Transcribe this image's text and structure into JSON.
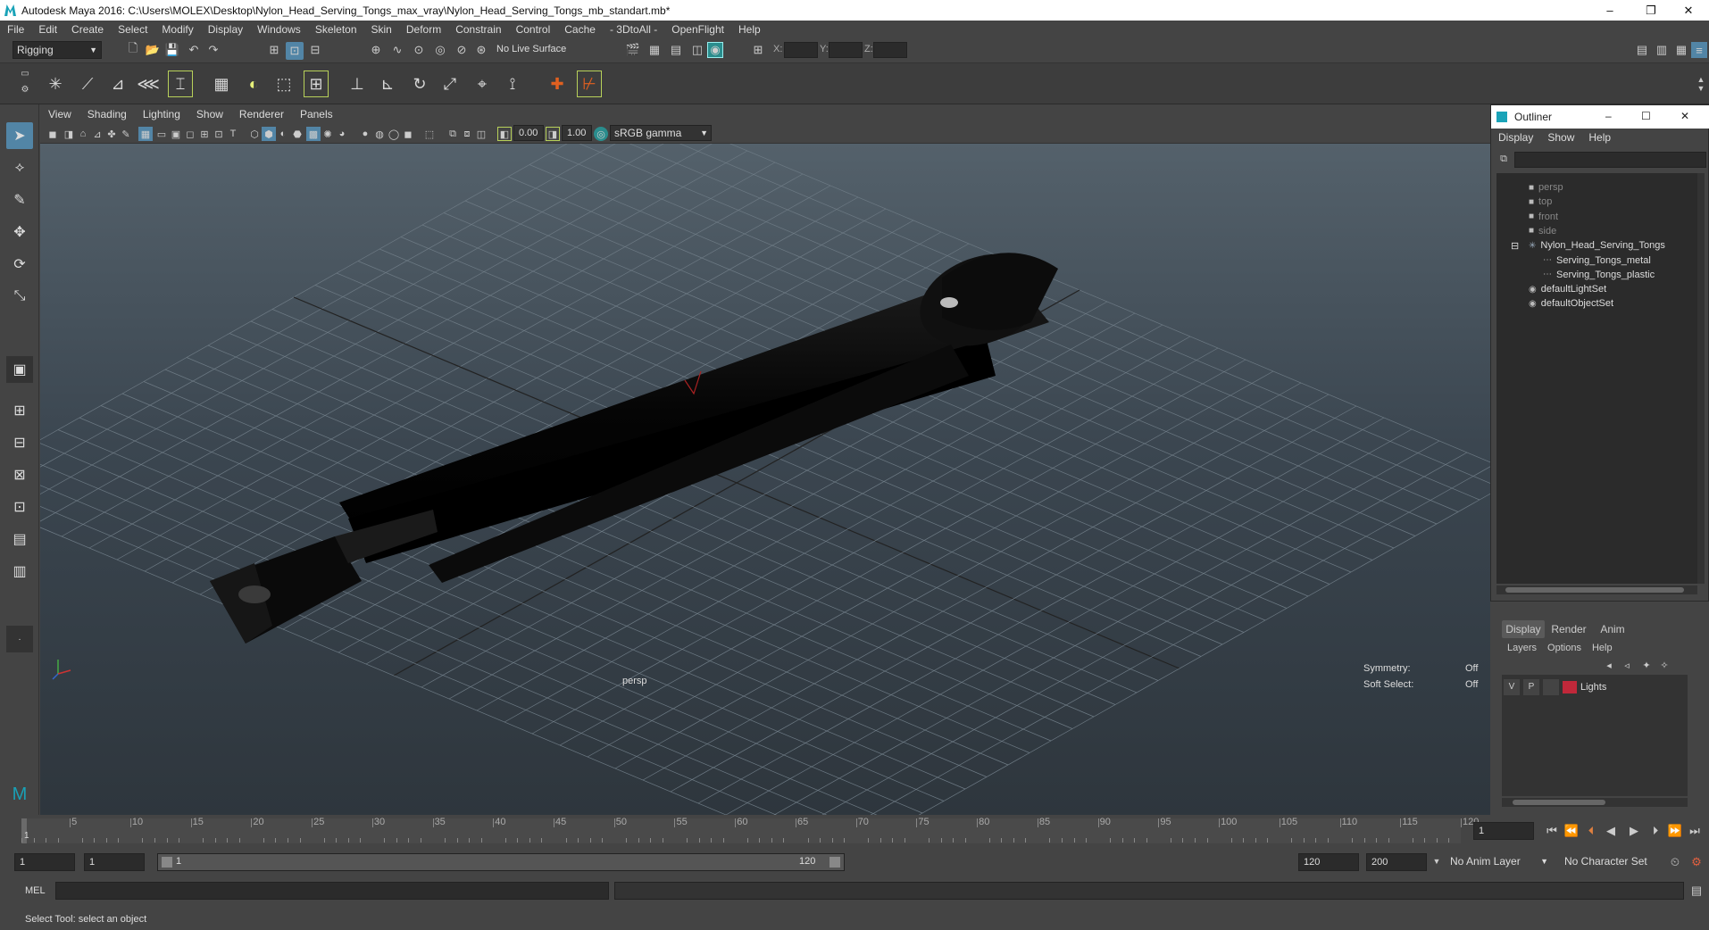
{
  "window": {
    "title": "Autodesk Maya 2016: C:\\Users\\MOLEX\\Desktop\\Nylon_Head_Serving_Tongs_max_vray\\Nylon_Head_Serving_Tongs_mb_standart.mb*",
    "minimize": "–",
    "maximize": "❐",
    "close": "✕"
  },
  "menubar": [
    "File",
    "Edit",
    "Create",
    "Select",
    "Modify",
    "Display",
    "Windows",
    "Skeleton",
    "Skin",
    "Deform",
    "Constrain",
    "Control",
    "Cache",
    "- 3DtoAll -",
    "OpenFlight",
    "Help"
  ],
  "status": {
    "menuset": "Rigging",
    "live_surface": "No Live Surface",
    "x_label": "X:",
    "y_label": "Y:",
    "z_label": "Z:"
  },
  "viewport_menu": [
    "View",
    "Shading",
    "Lighting",
    "Show",
    "Renderer",
    "Panels"
  ],
  "viewport_toolbar": {
    "exposure": "0.00",
    "gamma": "1.00",
    "color_space": "sRGB gamma"
  },
  "viewport": {
    "camera_label": "persp",
    "symmetry_label": "Symmetry:",
    "symmetry_value": "Off",
    "soft_select_label": "Soft Select:",
    "soft_select_value": "Off"
  },
  "outliner": {
    "title": "Outliner",
    "menu": [
      "Display",
      "Show",
      "Help"
    ],
    "items": [
      {
        "label": "persp",
        "type": "camera"
      },
      {
        "label": "top",
        "type": "camera"
      },
      {
        "label": "front",
        "type": "camera"
      },
      {
        "label": "side",
        "type": "camera"
      },
      {
        "label": "Nylon_Head_Serving_Tongs",
        "type": "group"
      },
      {
        "label": "Serving_Tongs_metal",
        "type": "mesh"
      },
      {
        "label": "Serving_Tongs_plastic",
        "type": "mesh"
      },
      {
        "label": "defaultLightSet",
        "type": "set"
      },
      {
        "label": "defaultObjectSet",
        "type": "set"
      }
    ]
  },
  "layers": {
    "tabs": [
      "Display",
      "Render",
      "Anim"
    ],
    "menu": [
      "Layers",
      "Options",
      "Help"
    ],
    "row": {
      "v": "V",
      "p": "P",
      "name": "Lights",
      "color": "#c0283a"
    }
  },
  "timeline": {
    "ticks": [
      "5",
      "10",
      "15",
      "20",
      "25",
      "30",
      "35",
      "40",
      "45",
      "50",
      "55",
      "60",
      "65",
      "70",
      "75",
      "80",
      "85",
      "90",
      "95",
      "100",
      "105",
      "110",
      "115",
      "120"
    ],
    "start_label": "1",
    "current_frame": "1"
  },
  "range": {
    "start": "1",
    "start_inner": "1",
    "slider_start": "1",
    "slider_end": "120",
    "end_inner": "120",
    "end": "200",
    "anim_layer": "No Anim Layer",
    "character_set": "No Character Set"
  },
  "cmd": {
    "label": "MEL"
  },
  "help": {
    "text": "Select Tool: select an object"
  },
  "colors": {
    "accent": "#5285a6",
    "layer_color": "#c0283a"
  }
}
